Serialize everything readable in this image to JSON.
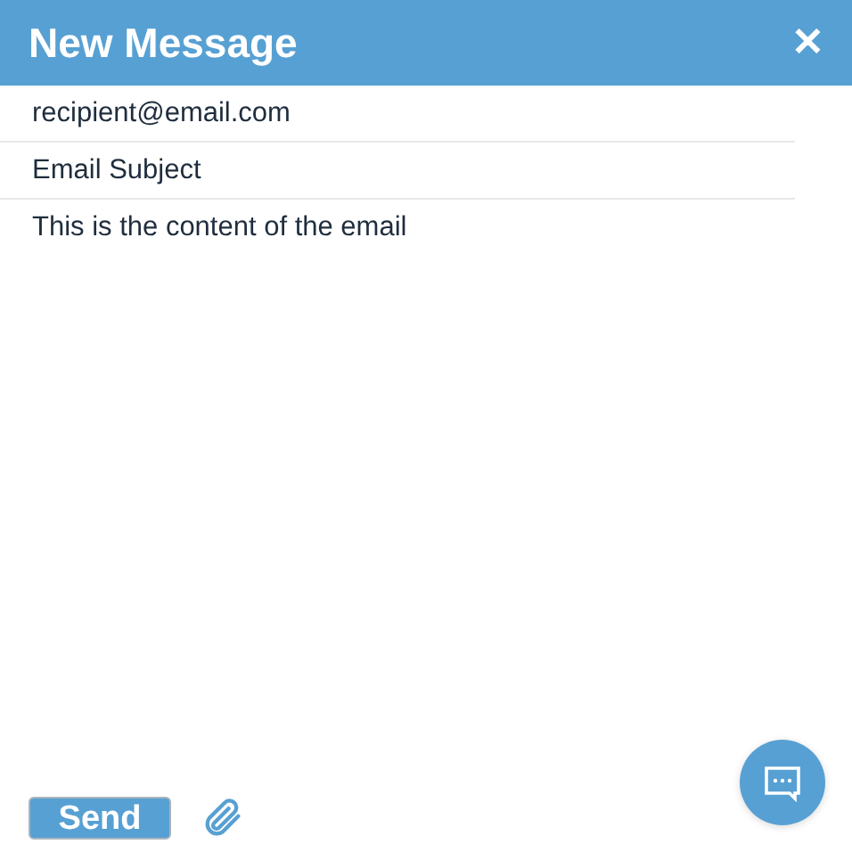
{
  "window": {
    "title": "New Message",
    "close": "✕"
  },
  "to": {
    "value": "recipient@email.com"
  },
  "subject": {
    "value": "Email Subject"
  },
  "body": {
    "value": "This is the content of the email"
  },
  "send": {
    "label": "Send"
  }
}
